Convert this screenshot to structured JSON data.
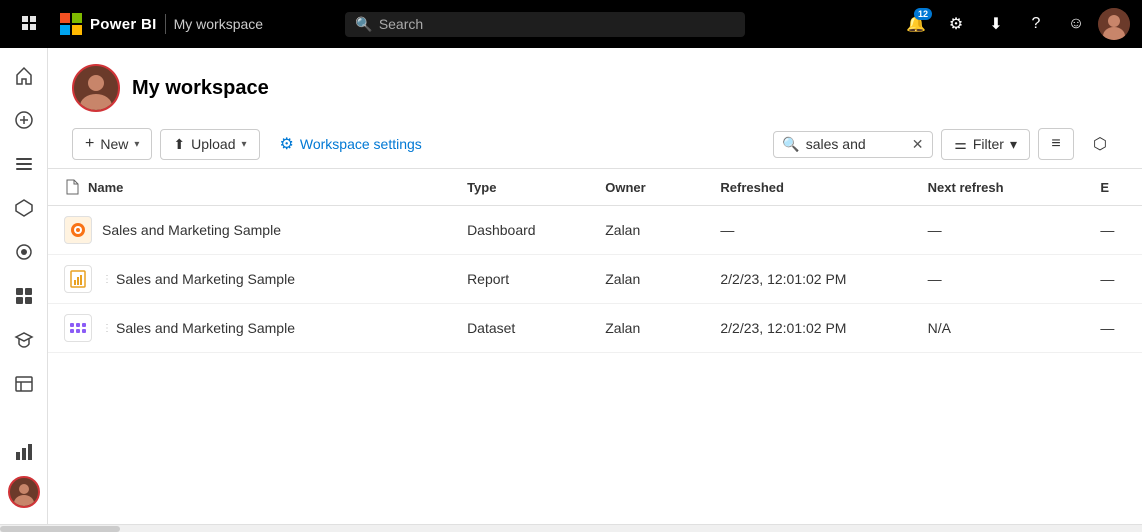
{
  "topnav": {
    "brand": "Power BI",
    "workspace": "My workspace",
    "search_placeholder": "Search",
    "notification_badge": "12",
    "icons": {
      "grid": "⊞",
      "bell": "🔔",
      "settings": "⚙",
      "download": "⬇",
      "help": "?",
      "face": "☺"
    }
  },
  "sidebar": {
    "items": [
      {
        "id": "home",
        "icon": "⌂",
        "label": "Home"
      },
      {
        "id": "create",
        "icon": "+",
        "label": "Create"
      },
      {
        "id": "browse",
        "icon": "☰",
        "label": "Browse"
      },
      {
        "id": "data-hub",
        "icon": "⬡",
        "label": "Data hub"
      },
      {
        "id": "monitoring",
        "icon": "📊",
        "label": "Monitoring hub"
      },
      {
        "id": "apps",
        "icon": "⬛",
        "label": "Apps"
      },
      {
        "id": "learn",
        "icon": "🎓",
        "label": "Learn"
      },
      {
        "id": "workspaces",
        "icon": "📋",
        "label": "Workspaces"
      }
    ]
  },
  "workspace": {
    "title": "My workspace"
  },
  "toolbar": {
    "new_label": "New",
    "upload_label": "Upload",
    "settings_label": "Workspace settings",
    "filter_label": "Filter",
    "search_value": "sales and",
    "view_icon": "≡",
    "lineage_icon": "⬡"
  },
  "table": {
    "columns": [
      {
        "id": "name",
        "label": "Name"
      },
      {
        "id": "type",
        "label": "Type"
      },
      {
        "id": "owner",
        "label": "Owner"
      },
      {
        "id": "refreshed",
        "label": "Refreshed"
      },
      {
        "id": "next_refresh",
        "label": "Next refresh"
      },
      {
        "id": "e",
        "label": "E"
      }
    ],
    "rows": [
      {
        "id": "row-1",
        "icon_type": "dashboard",
        "name": "Sales and Marketing Sample",
        "type": "Dashboard",
        "owner": "Zalan",
        "refreshed": "—",
        "next_refresh": "—",
        "e": "—"
      },
      {
        "id": "row-2",
        "icon_type": "report",
        "name": "Sales and Marketing Sample",
        "type": "Report",
        "owner": "Zalan",
        "refreshed": "2/2/23, 12:01:02 PM",
        "next_refresh": "—",
        "e": "—"
      },
      {
        "id": "row-3",
        "icon_type": "dataset",
        "name": "Sales and Marketing Sample",
        "type": "Dataset",
        "owner": "Zalan",
        "refreshed": "2/2/23, 12:01:02 PM",
        "next_refresh": "N/A",
        "e": "—"
      }
    ]
  }
}
